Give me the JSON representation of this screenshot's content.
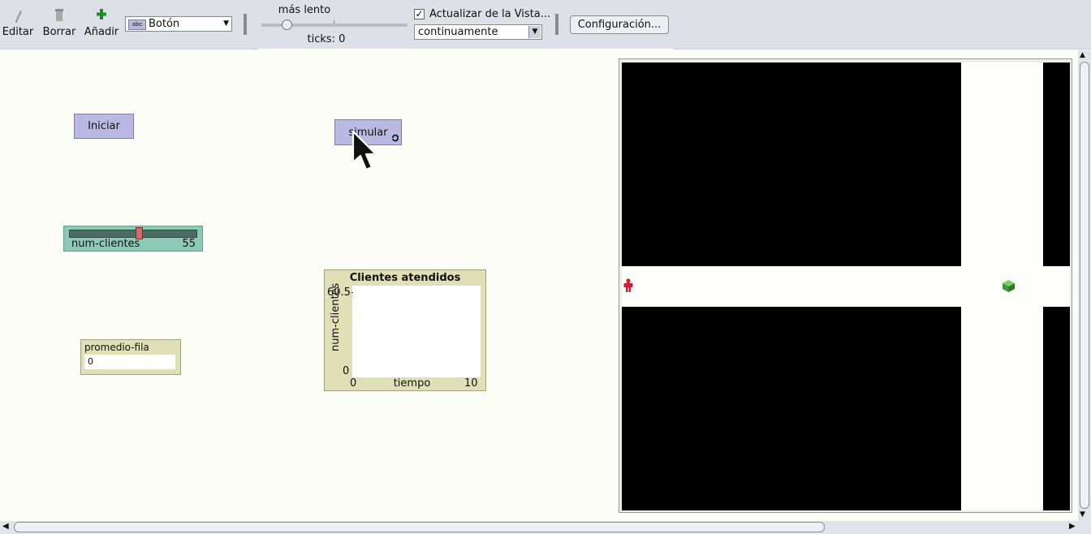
{
  "toolbar": {
    "edit_label": "Editar",
    "delete_label": "Borrar",
    "add_label": "Añadir",
    "widget_type": "Botón",
    "widget_icon_text": "abc",
    "speed_label": "más lento",
    "ticks_label": "ticks: 0",
    "speed_value": 0.15,
    "update_checked": "✓",
    "update_label": "Actualizar de la Vista...",
    "update_mode": "continuamente",
    "settings_label": "Configuración..."
  },
  "widgets": {
    "setup_label": "Iniciar",
    "go_label": "simular",
    "slider": {
      "name": "num-clientes",
      "value": "55",
      "position": 0.55
    },
    "monitor": {
      "label": "promedio-fila",
      "value": "0"
    },
    "plot": {
      "title": "Clientes atendidos",
      "ylabel": "num-clientes",
      "xlabel": "tiempo",
      "ymax": "60.5",
      "ymin": "0",
      "xmin": "0",
      "xmax": "10"
    }
  },
  "colors": {
    "button": "#b9b9e3",
    "slider": "#8dc9b7",
    "monitor": "#dfe0b5",
    "person_agent": "#d21f2b",
    "box_agent": "#4aa83a"
  },
  "icons": [
    "pencil-icon",
    "trash-icon",
    "plus-icon",
    "forever-icon",
    "mouse-cursor-icon",
    "person-icon",
    "box-icon"
  ]
}
